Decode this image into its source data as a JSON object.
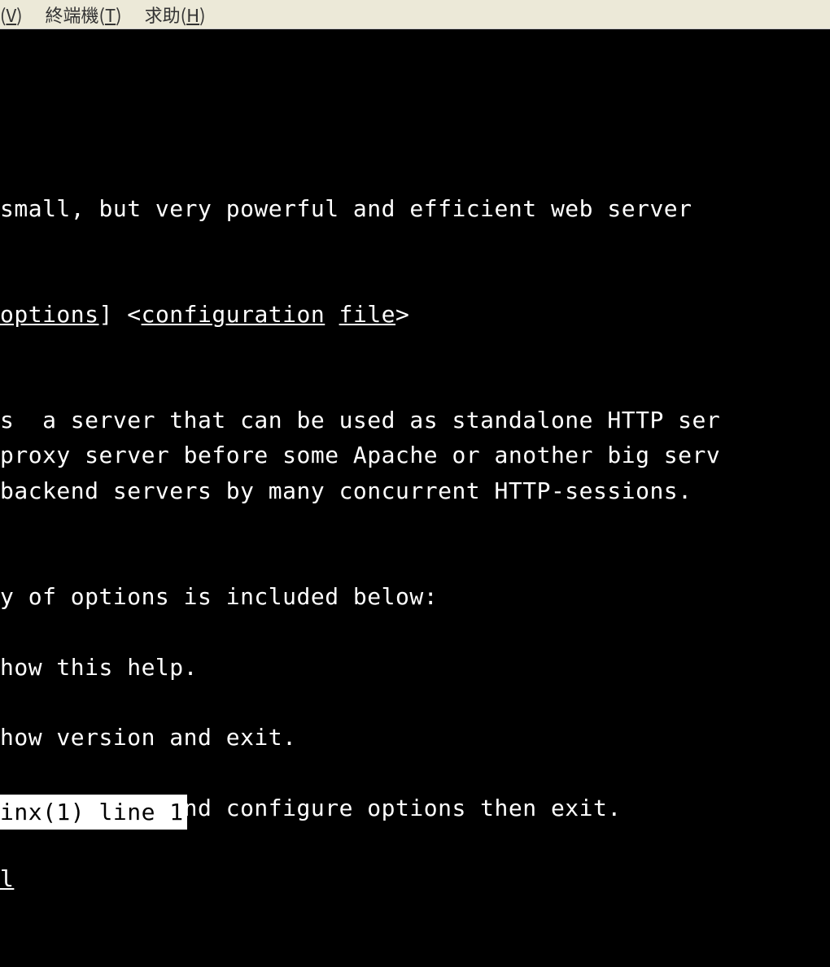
{
  "menubar": {
    "items": [
      {
        "prefix": "(",
        "accel": "V",
        "suffix": ")",
        "pre_text": ""
      },
      {
        "pre_text": "終端機",
        "prefix": "(",
        "accel": "T",
        "suffix": ")"
      },
      {
        "pre_text": "求助",
        "prefix": "(",
        "accel": "H",
        "suffix": ")"
      }
    ]
  },
  "manpage": {
    "name_line": "small, but very powerful and efficient web server",
    "synopsis": {
      "bracket_open": "",
      "options": "options",
      "bracket_mid": "] <",
      "conf": "configuration",
      "space": " ",
      "file": "file",
      "bracket_close": ">"
    },
    "desc_line1": "s  a server that can be used as standalone HTTP ser",
    "desc_line2": "proxy server before some Apache or another big serv",
    "desc_line3": "backend servers by many concurrent HTTP-sessions.",
    "options_intro": "y of options is included below:",
    "opt_h": "how this help.",
    "opt_v": "how version and exit.",
    "opt_V": "how version and configure options then exit.",
    "opt_last_underlined": "l"
  },
  "statusline": "inx(1) line 1"
}
